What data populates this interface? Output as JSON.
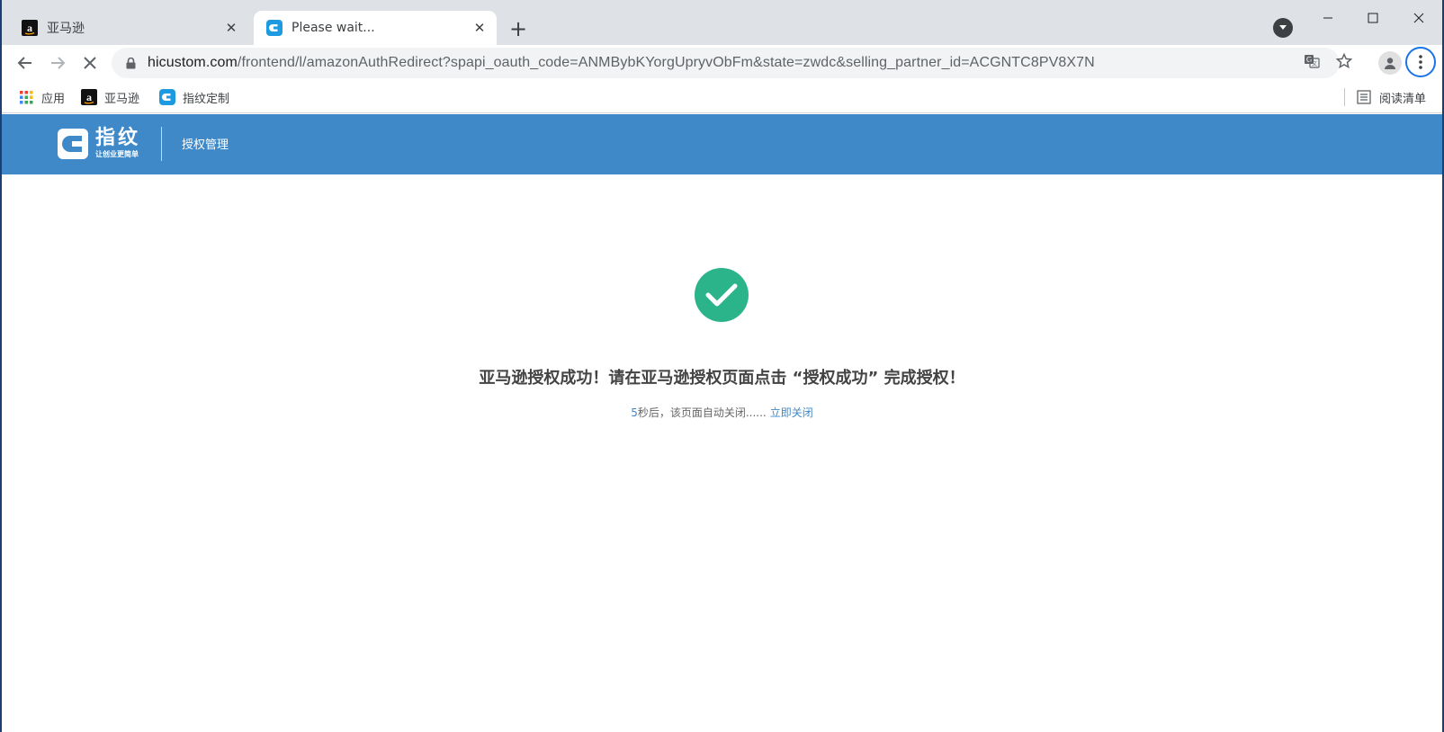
{
  "browser": {
    "tabs": [
      {
        "title": "亚马逊",
        "favicon": "amazon-icon",
        "active": false
      },
      {
        "title": "Please wait...",
        "favicon": "fingerprint-logo-icon",
        "active": true
      }
    ],
    "url": {
      "host": "hicustom.com",
      "path": "/frontend/l/amazonAuthRedirect?spapi_oauth_code=ANMBybKYorgUpryvObFm&state=zwdc&selling_partner_id=ACGNTC8PV8X7N"
    },
    "bookmarks": [
      {
        "label": "应用",
        "icon": "apps-grid-icon"
      },
      {
        "label": "亚马逊",
        "icon": "amazon-icon"
      },
      {
        "label": "指纹定制",
        "icon": "fingerprint-logo-icon"
      }
    ],
    "reading_list": "阅读清单"
  },
  "site": {
    "logo_main": "指纹",
    "logo_sub": "让创业更简单",
    "nav_label": "授权管理"
  },
  "main": {
    "message": "亚马逊授权成功！请在亚马逊授权页面点击 “授权成功” 完成授权！",
    "countdown_number": "5",
    "countdown_text": "秒后，该页面自动关闭......",
    "close_now": "立即关闭"
  },
  "colors": {
    "header": "#3f89c9",
    "success": "#2bb38a",
    "link": "#3f89c9"
  }
}
